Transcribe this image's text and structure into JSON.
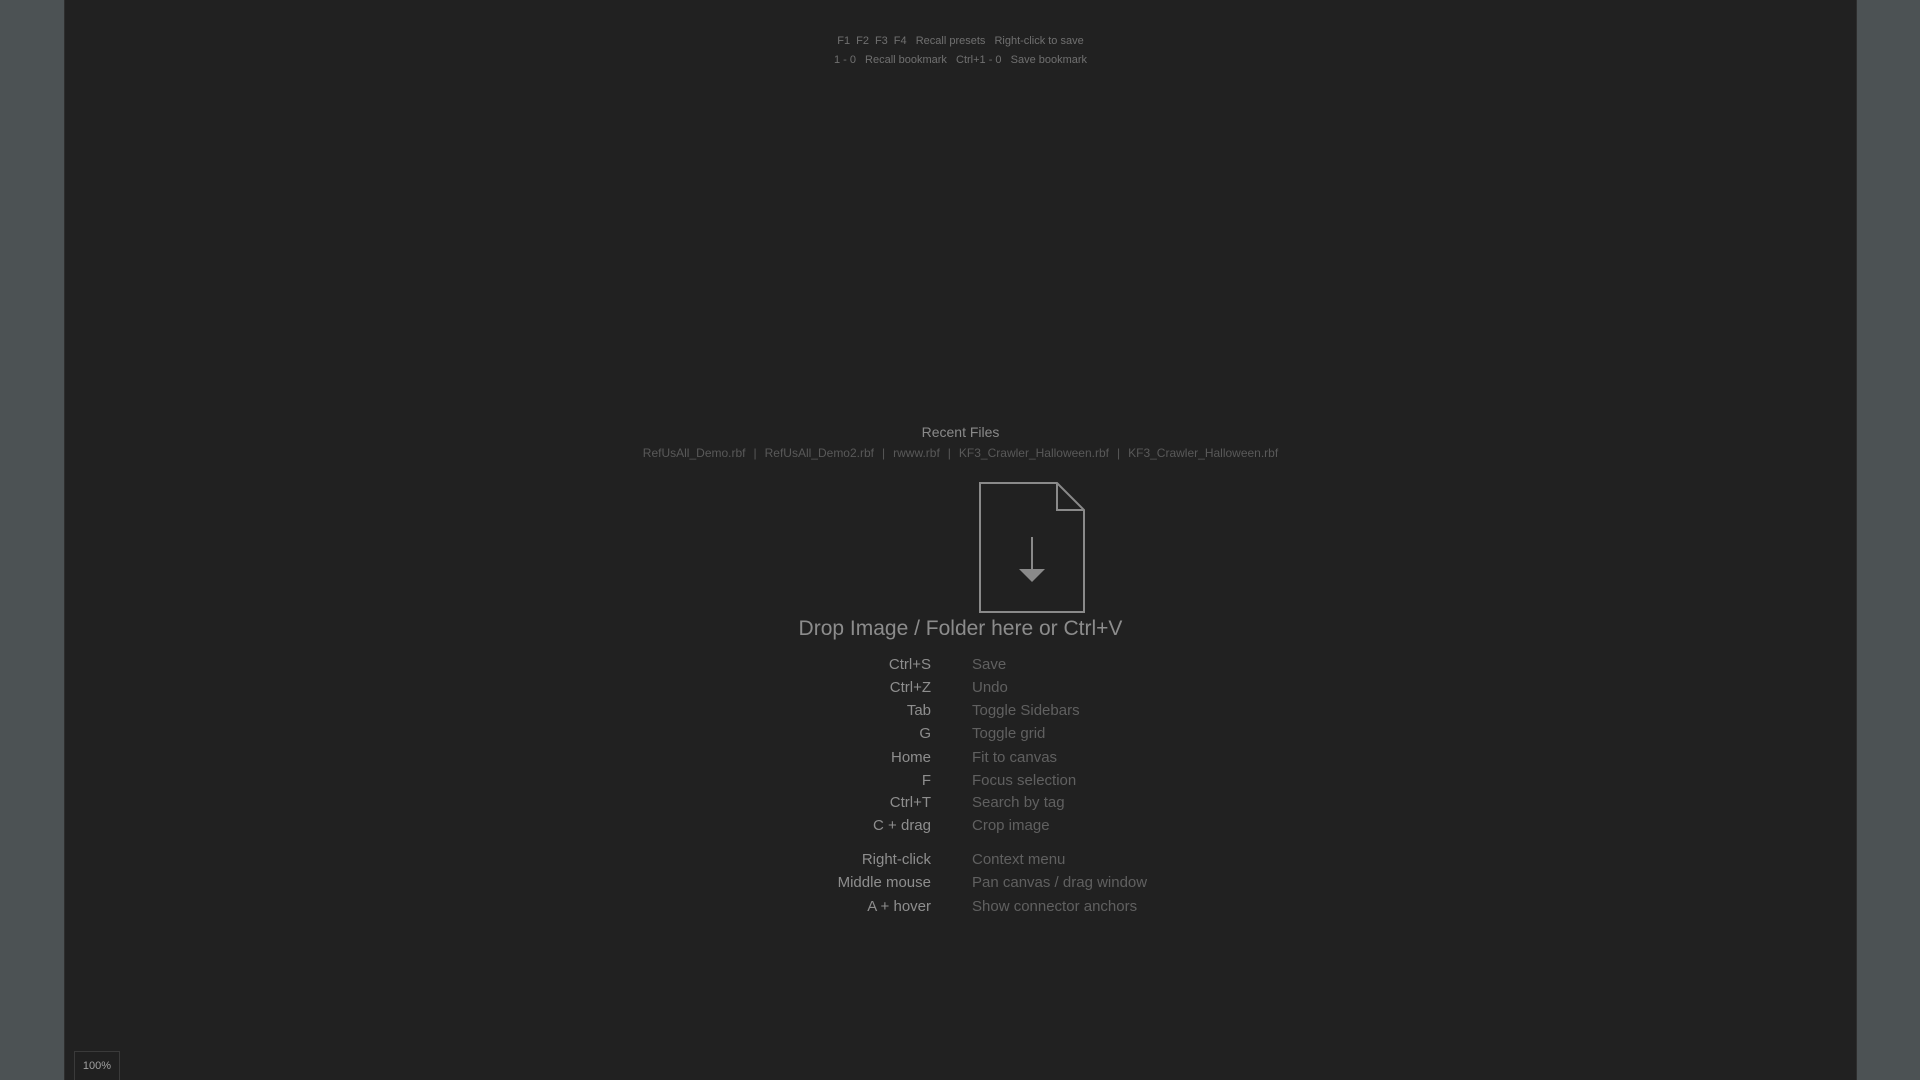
{
  "hints": {
    "row1": [
      "F1",
      "F2",
      "F3",
      "F4",
      "Recall presets",
      "Right-click to save"
    ],
    "row2": [
      "1 - 0",
      "Recall bookmark",
      "Ctrl+1 - 0",
      "Save bookmark"
    ]
  },
  "recent_files": {
    "title": "Recent Files",
    "files": [
      "RefUsAll_Demo.rbf",
      "RefUsAll_Demo2.rbf",
      "rwww.rbf",
      "KF3_Crawler_Halloween.rbf",
      "KF3_Crawler_Halloween.rbf"
    ],
    "separator": "|"
  },
  "drop": {
    "icon": "file-download-icon",
    "text": "Drop Image / Folder here or Ctrl+V"
  },
  "shortcuts": [
    {
      "key": "Ctrl+S",
      "desc": "Save"
    },
    {
      "key": "Ctrl+Z",
      "desc": "Undo"
    },
    {
      "key": "Tab",
      "desc": "Toggle Sidebars"
    },
    {
      "key": "G",
      "desc": "Toggle grid"
    },
    {
      "key": "Home",
      "desc": "Fit to canvas"
    },
    {
      "key": "F",
      "desc": "Focus selection"
    },
    {
      "key": "Ctrl+T",
      "desc": "Search by tag"
    },
    {
      "key": "C + drag",
      "desc": "Crop image"
    },
    {
      "key": "Right-click",
      "desc": "Context menu"
    },
    {
      "key": "Middle mouse",
      "desc": "Pan canvas / drag window"
    },
    {
      "key": "A + hover",
      "desc": "Show connector anchors"
    }
  ],
  "zoom": {
    "label": "100%"
  },
  "colors": {
    "canvas_bg": "#212121",
    "sidebar_bg": "#4c5254",
    "text_key": "#8e8e8e",
    "text_desc": "#606060"
  }
}
